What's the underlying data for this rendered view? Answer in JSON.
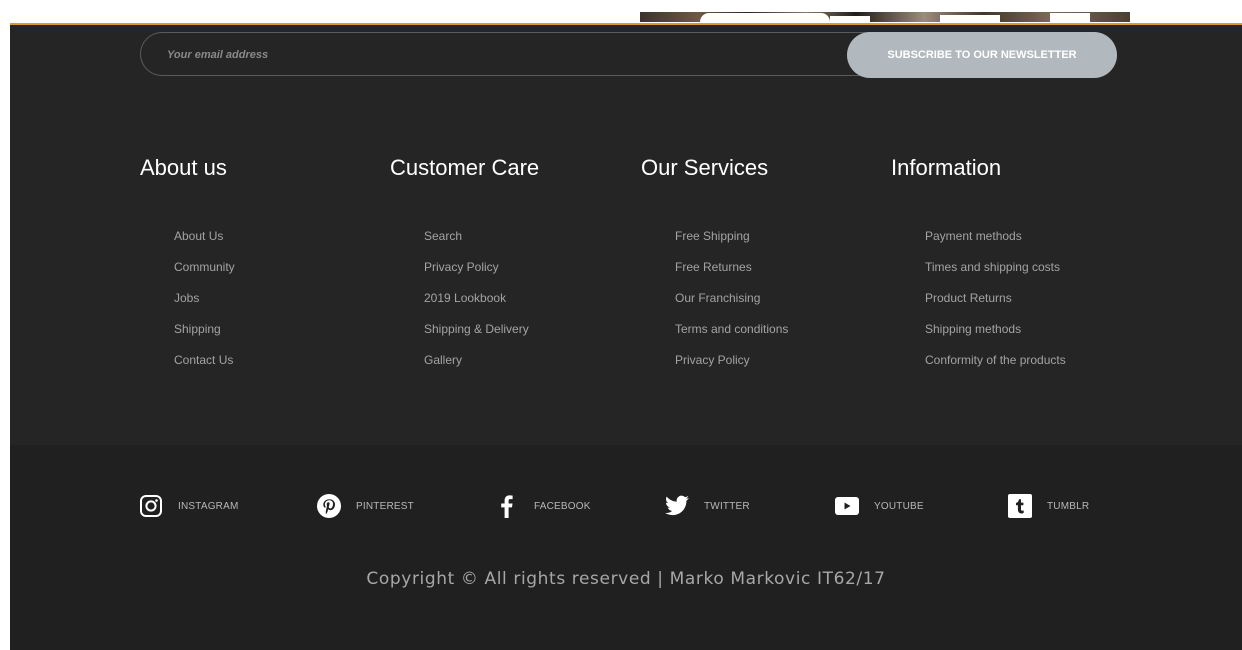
{
  "newsletter": {
    "placeholder": "Your email address",
    "button_label": "SUBSCRIBE TO OUR NEWSLETTER"
  },
  "columns": [
    {
      "title": "About us",
      "links": [
        "About Us",
        "Community",
        "Jobs",
        "Shipping",
        "Contact Us"
      ]
    },
    {
      "title": "Customer Care",
      "links": [
        "Search",
        "Privacy Policy",
        "2019 Lookbook",
        "Shipping & Delivery",
        "Gallery"
      ]
    },
    {
      "title": "Our Services",
      "links": [
        "Free Shipping",
        "Free Returnes",
        "Our Franchising",
        "Terms and conditions",
        "Privacy Policy"
      ]
    },
    {
      "title": "Information",
      "links": [
        "Payment methods",
        "Times and shipping costs",
        "Product Returns",
        "Shipping methods",
        "Conformity of the products"
      ]
    }
  ],
  "social": [
    {
      "label": "INSTAGRAM",
      "icon": "instagram-icon"
    },
    {
      "label": "PINTEREST",
      "icon": "pinterest-icon"
    },
    {
      "label": "FACEBOOK",
      "icon": "facebook-icon"
    },
    {
      "label": "TWITTER",
      "icon": "twitter-icon"
    },
    {
      "label": "YOUTUBE",
      "icon": "youtube-icon"
    },
    {
      "label": "TUMBLR",
      "icon": "tumblr-icon"
    }
  ],
  "copyright": "Copyright © All rights reserved | Marko Markovic IT62/17",
  "colors": {
    "footer_bg": "#252525",
    "social_bg": "#202020",
    "accent": "#d79a2b",
    "button_bg": "#b1b9be"
  }
}
